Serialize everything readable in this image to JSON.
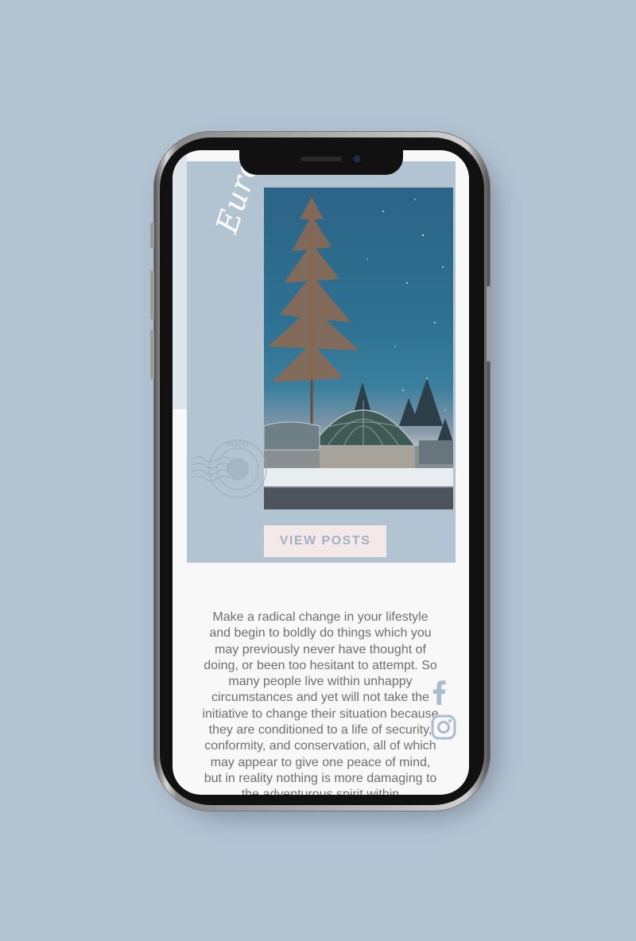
{
  "hero": {
    "destination": "Europe",
    "stamp_text": "TRAVEL",
    "cta_label": "VIEW POSTS"
  },
  "intro": {
    "text": "Make a radical change in your lifestyle and begin to boldly do things which you may previously never have thought of doing, or been too hesitant to attempt. So many people live within unhappy circumstances and yet will not take the initiative to change their situation because they are conditioned to a life of security, conformity, and conservation, all of which may appear to give one peace of mind, but in reality nothing is more damaging to the adventurous spirit within"
  },
  "social": {
    "icons": [
      "facebook-icon",
      "instagram-icon"
    ]
  },
  "colors": {
    "background": "#b2c3d2",
    "panel": "#b2c3d2",
    "button_bg": "#f5e8e8",
    "button_text": "#9fb3c5",
    "body_text": "#6e6e6e",
    "icon": "#a9bccd"
  }
}
